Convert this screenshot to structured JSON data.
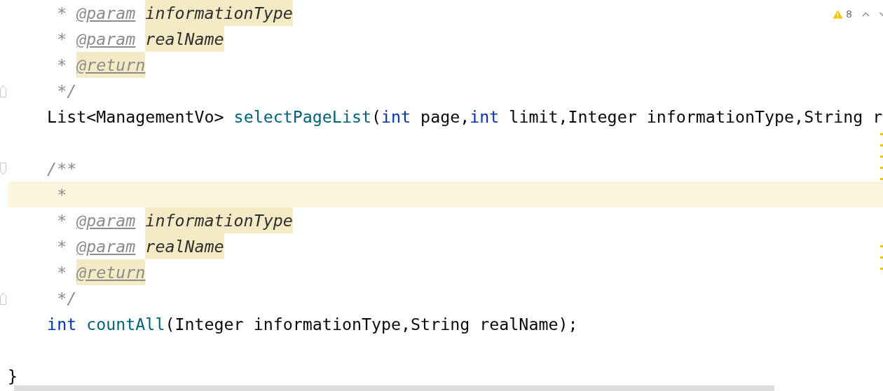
{
  "editor": {
    "lines": [
      {
        "kind": "code",
        "current": false,
        "tokens": [
          {
            "kind": "comment",
            "text": "     * "
          },
          {
            "kind": "tag",
            "text": "@param"
          },
          {
            "kind": "param",
            "text": "informationType",
            "highlight": true
          }
        ]
      },
      {
        "kind": "code",
        "current": false,
        "tokens": [
          {
            "kind": "comment",
            "text": "     * "
          },
          {
            "kind": "tag",
            "text": "@param"
          },
          {
            "kind": "param",
            "text": "realName",
            "highlight": true
          }
        ]
      },
      {
        "kind": "code",
        "current": false,
        "tokens": [
          {
            "kind": "comment",
            "text": "     * "
          },
          {
            "kind": "tag",
            "text": "@return",
            "highlight": true
          }
        ]
      },
      {
        "kind": "code",
        "current": false,
        "fold_end": true,
        "tokens": [
          {
            "kind": "comment",
            "text": "     */"
          }
        ]
      },
      {
        "kind": "code",
        "current": false,
        "tokens": [
          {
            "kind": "plain",
            "text": "    List<ManagementVo> "
          },
          {
            "kind": "method",
            "text": "selectPageList"
          },
          {
            "kind": "plain",
            "text": "("
          },
          {
            "kind": "keyword",
            "text": "int"
          },
          {
            "kind": "plain",
            "text": " page,"
          },
          {
            "kind": "keyword",
            "text": "int"
          },
          {
            "kind": "plain",
            "text": " limit,Integer informationType,String r"
          }
        ]
      },
      {
        "kind": "blank"
      },
      {
        "kind": "code",
        "current": false,
        "fold_start": true,
        "tokens": [
          {
            "kind": "comment",
            "text": "    /**"
          }
        ]
      },
      {
        "kind": "code",
        "current": true,
        "tokens": [
          {
            "kind": "comment",
            "text": "     *"
          }
        ]
      },
      {
        "kind": "code",
        "current": false,
        "tokens": [
          {
            "kind": "comment",
            "text": "     * "
          },
          {
            "kind": "tag",
            "text": "@param"
          },
          {
            "kind": "param",
            "text": "informationType",
            "highlight": true
          }
        ]
      },
      {
        "kind": "code",
        "current": false,
        "tokens": [
          {
            "kind": "comment",
            "text": "     * "
          },
          {
            "kind": "tag",
            "text": "@param"
          },
          {
            "kind": "param",
            "text": "realName",
            "highlight": true
          }
        ]
      },
      {
        "kind": "code",
        "current": false,
        "tokens": [
          {
            "kind": "comment",
            "text": "     * "
          },
          {
            "kind": "tag",
            "text": "@return",
            "highlight": true
          }
        ]
      },
      {
        "kind": "code",
        "current": false,
        "fold_end": true,
        "tokens": [
          {
            "kind": "comment",
            "text": "     */"
          }
        ]
      },
      {
        "kind": "code",
        "current": false,
        "tokens": [
          {
            "kind": "keyword",
            "text": "    int "
          },
          {
            "kind": "method",
            "text": "countAll"
          },
          {
            "kind": "plain",
            "text": "(Integer informationType,String realName);"
          }
        ]
      },
      {
        "kind": "blank"
      },
      {
        "kind": "code",
        "current": false,
        "tokens": [
          {
            "kind": "plain",
            "text": "}"
          }
        ]
      }
    ]
  },
  "inspection_widget": {
    "warnings": "8"
  }
}
